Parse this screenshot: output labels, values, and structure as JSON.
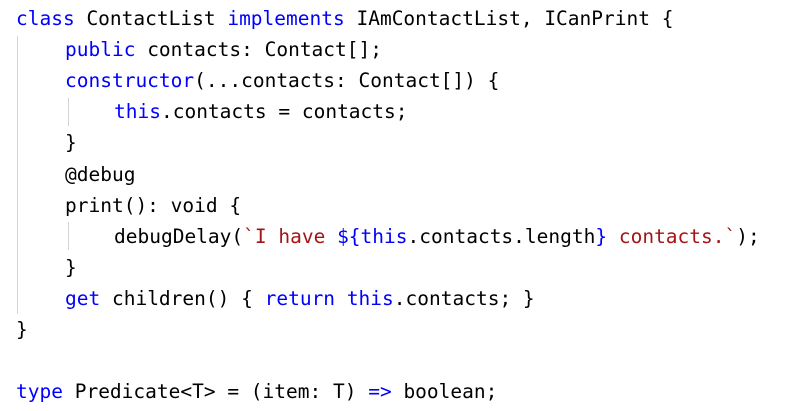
{
  "colors": {
    "background": "#ffffff",
    "keyword": "#0000ff",
    "string": "#a31515",
    "text": "#000000",
    "indent_guide": "#d3d3d3"
  },
  "code": {
    "lines": [
      {
        "id": "class-declaration-line",
        "tokens": [
          {
            "t": "class",
            "c": "kw"
          },
          {
            "t": " ContactList ",
            "c": "plain"
          },
          {
            "t": "implements",
            "c": "kw"
          },
          {
            "t": " IAmContactList, ICanPrint {",
            "c": "plain"
          }
        ]
      },
      {
        "id": "contacts-field-line",
        "indent": 1,
        "tokens": [
          {
            "t": "public",
            "c": "kw"
          },
          {
            "t": " contacts: Contact[];",
            "c": "plain"
          }
        ]
      },
      {
        "id": "constructor-line",
        "indent": 1,
        "tokens": [
          {
            "t": "constructor",
            "c": "kw"
          },
          {
            "t": "(...contacts: Contact[]) {",
            "c": "plain"
          }
        ]
      },
      {
        "id": "constructor-body-line",
        "indent": 2,
        "tokens": [
          {
            "t": "this",
            "c": "kw"
          },
          {
            "t": ".contacts = contacts;",
            "c": "plain"
          }
        ]
      },
      {
        "id": "constructor-close-line",
        "indent": 1,
        "tokens": [
          {
            "t": "}",
            "c": "plain"
          }
        ]
      },
      {
        "id": "decorator-line",
        "indent": 1,
        "tokens": [
          {
            "t": "@debug",
            "c": "plain"
          }
        ]
      },
      {
        "id": "print-method-line",
        "indent": 1,
        "tokens": [
          {
            "t": "print(): ",
            "c": "plain"
          },
          {
            "t": "void",
            "c": "plain"
          },
          {
            "t": " {",
            "c": "plain"
          }
        ]
      },
      {
        "id": "print-body-line",
        "indent": 2,
        "tokens": [
          {
            "t": "debugDelay(",
            "c": "plain"
          },
          {
            "t": "`I have ",
            "c": "str"
          },
          {
            "t": "${",
            "c": "kw"
          },
          {
            "t": "this",
            "c": "kw"
          },
          {
            "t": ".contacts.length",
            "c": "plain"
          },
          {
            "t": "}",
            "c": "kw"
          },
          {
            "t": " contacts.`",
            "c": "str"
          },
          {
            "t": ");",
            "c": "plain"
          }
        ]
      },
      {
        "id": "print-close-line",
        "indent": 1,
        "tokens": [
          {
            "t": "}",
            "c": "plain"
          }
        ]
      },
      {
        "id": "children-getter-line",
        "indent": 1,
        "tokens": [
          {
            "t": "get",
            "c": "kw"
          },
          {
            "t": " children() { ",
            "c": "plain"
          },
          {
            "t": "return",
            "c": "kw"
          },
          {
            "t": " ",
            "c": "plain"
          },
          {
            "t": "this",
            "c": "kw"
          },
          {
            "t": ".contacts; }",
            "c": "plain"
          }
        ]
      },
      {
        "id": "class-close-line",
        "tokens": [
          {
            "t": "}",
            "c": "plain"
          }
        ]
      },
      {
        "id": "blank-line",
        "tokens": []
      },
      {
        "id": "type-alias-line",
        "tokens": [
          {
            "t": "type",
            "c": "kw"
          },
          {
            "t": " Predicate<T> = (item: T) ",
            "c": "plain"
          },
          {
            "t": "=>",
            "c": "kw"
          },
          {
            "t": " boolean;",
            "c": "plain"
          }
        ]
      }
    ]
  }
}
